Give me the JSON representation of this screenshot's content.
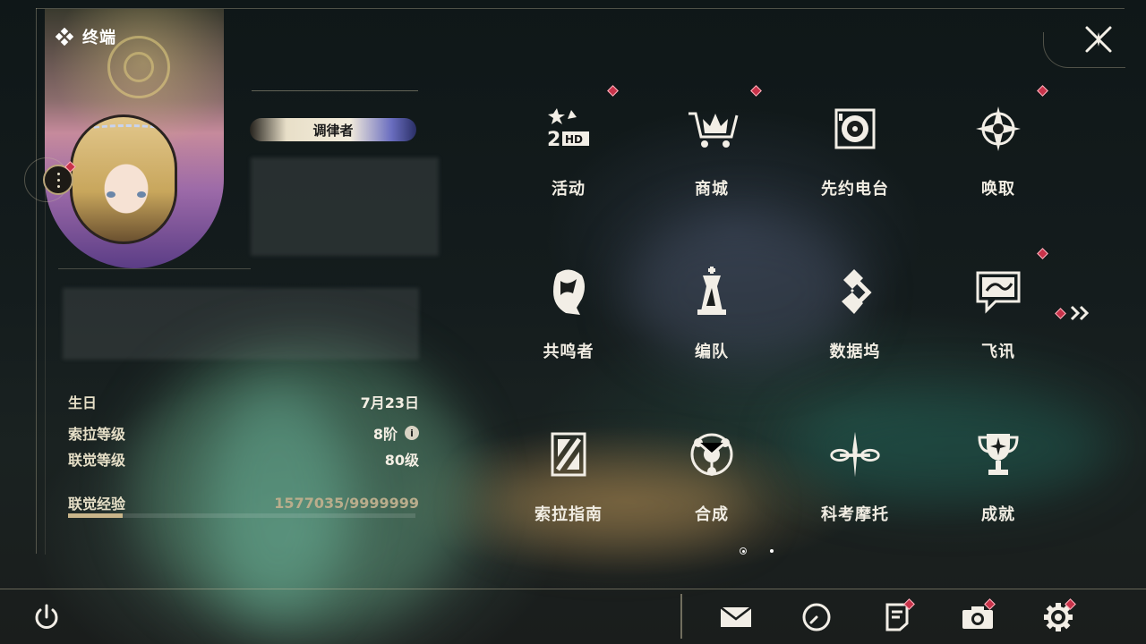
{
  "profile": {
    "section_title": "终端",
    "title_badge": "调律者"
  },
  "stats": {
    "birthday_label": "生日",
    "birthday_value": "7月23日",
    "sola_level_label": "索拉等级",
    "sola_level_value": "8阶",
    "union_level_label": "联觉等级",
    "union_level_value": "80级",
    "union_exp_label": "联觉经验",
    "union_exp_value": "1577035/9999999",
    "union_exp_progress": 0.158
  },
  "menu": {
    "items": [
      {
        "label": "活动",
        "icon": "event-2hd-icon",
        "badge": true
      },
      {
        "label": "商城",
        "icon": "shop-cart-icon",
        "badge": true
      },
      {
        "label": "先约电台",
        "icon": "radio-icon",
        "badge": false
      },
      {
        "label": "唤取",
        "icon": "convene-compass-icon",
        "badge": true
      },
      {
        "label": "共鸣者",
        "icon": "resonator-head-icon",
        "badge": false
      },
      {
        "label": "编队",
        "icon": "team-chess-icon",
        "badge": false
      },
      {
        "label": "数据坞",
        "icon": "data-bank-icon",
        "badge": false
      },
      {
        "label": "飞讯",
        "icon": "message-chat-icon",
        "badge": true
      },
      {
        "label": "索拉指南",
        "icon": "guide-book-icon",
        "badge": false
      },
      {
        "label": "合成",
        "icon": "synthesis-icon",
        "badge": false
      },
      {
        "label": "科考摩托",
        "icon": "motorcycle-icon",
        "badge": false
      },
      {
        "label": "成就",
        "icon": "trophy-icon",
        "badge": false
      }
    ]
  },
  "icons": {
    "close": "close-x-icon",
    "more": "more-dots-icon",
    "info": "info-icon",
    "next_page": "double-chevron-right-icon",
    "power": "power-icon",
    "mail": "mail-icon",
    "clock": "clock-icon",
    "notice": "notice-icon",
    "camera": "camera-icon",
    "settings": "gear-icon"
  },
  "colors": {
    "badge": "#c8334a",
    "accent": "#c9b58a"
  }
}
